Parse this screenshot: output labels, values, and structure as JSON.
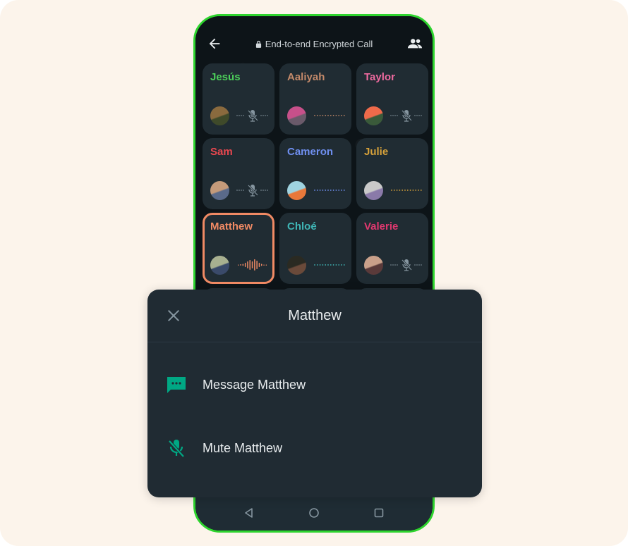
{
  "call": {
    "title": "End-to-end Encrypted Call",
    "back_icon": "arrow-left-icon",
    "lock_icon": "lock-icon",
    "participants_icon": "people-icon"
  },
  "participants": [
    {
      "name": "Jesús",
      "color": "#4ccf5a",
      "state": "muted",
      "avatar_colors": [
        "#8a6a3e",
        "#3f4a2a"
      ]
    },
    {
      "name": "Aaliyah",
      "color": "#c48a6a",
      "state": "idle",
      "avatar_colors": [
        "#c7508a",
        "#6a5a6a"
      ]
    },
    {
      "name": "Taylor",
      "color": "#ee6a9f",
      "state": "muted",
      "avatar_colors": [
        "#ef6a4a",
        "#3a5a3a"
      ]
    },
    {
      "name": "Sam",
      "color": "#e8474f",
      "state": "muted",
      "avatar_colors": [
        "#c49a7a",
        "#5a6a8a"
      ]
    },
    {
      "name": "Cameron",
      "color": "#6f8ff0",
      "state": "idle",
      "avatar_colors": [
        "#9fd3e0",
        "#e8783a"
      ]
    },
    {
      "name": "Julie",
      "color": "#d6a13a",
      "state": "idle",
      "avatar_colors": [
        "#c9c9c9",
        "#8a7aa9"
      ]
    },
    {
      "name": "Matthew",
      "color": "#f08a64",
      "state": "speaking",
      "active": true,
      "avatar_colors": [
        "#a8b090",
        "#3a4a6a"
      ]
    },
    {
      "name": "Chloé",
      "color": "#3fb6b6",
      "state": "idle",
      "avatar_colors": [
        "#2a2a22",
        "#6a4a3a"
      ]
    },
    {
      "name": "Valerie",
      "color": "#e0386f",
      "state": "muted",
      "avatar_colors": [
        "#c9a08a",
        "#5a3a3a"
      ]
    }
  ],
  "sheet": {
    "title": "Matthew",
    "close_icon": "close-icon",
    "items": [
      {
        "label": "Message Matthew",
        "icon": "message-icon"
      },
      {
        "label": "Mute Matthew",
        "icon": "mic-off-icon"
      }
    ],
    "accent": "#00a884"
  },
  "navbar": {
    "back": "nav-back-icon",
    "home": "nav-home-icon",
    "recents": "nav-recents-icon"
  }
}
